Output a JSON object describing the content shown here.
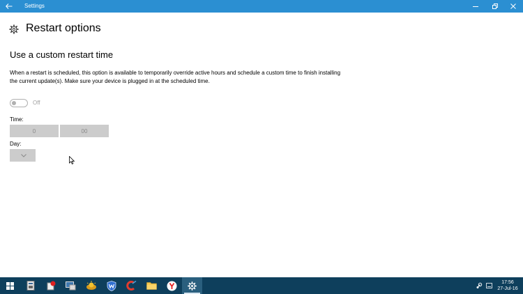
{
  "window": {
    "title": "Settings",
    "titlebar_color": "#2b8fd2"
  },
  "page": {
    "title": "Restart options"
  },
  "section": {
    "title": "Use a custom restart time",
    "description": "When a restart is scheduled, this option is available to temporarily override active hours and schedule a custom time to finish installing the current update(s). Make sure your device is plugged in at the scheduled time."
  },
  "toggle": {
    "state": "Off",
    "enabled": false
  },
  "time": {
    "label": "Time:",
    "hour": "0",
    "minute": "00"
  },
  "day": {
    "label": "Day:",
    "value": ""
  },
  "taskbar": {
    "color": "#0e3f5c",
    "items": [
      {
        "icon": "windows-start-icon"
      },
      {
        "icon": "task-manager-icon"
      },
      {
        "icon": "app-red-badge-icon"
      },
      {
        "icon": "computer-icon"
      },
      {
        "icon": "sun-app-icon"
      },
      {
        "icon": "malwarebytes-icon"
      },
      {
        "icon": "ccleaner-icon"
      },
      {
        "icon": "file-explorer-icon"
      },
      {
        "icon": "yandex-browser-icon"
      },
      {
        "icon": "settings-gear-icon",
        "active": true
      }
    ],
    "clock": {
      "time": "17:56",
      "date": "27-Jul-16"
    }
  }
}
